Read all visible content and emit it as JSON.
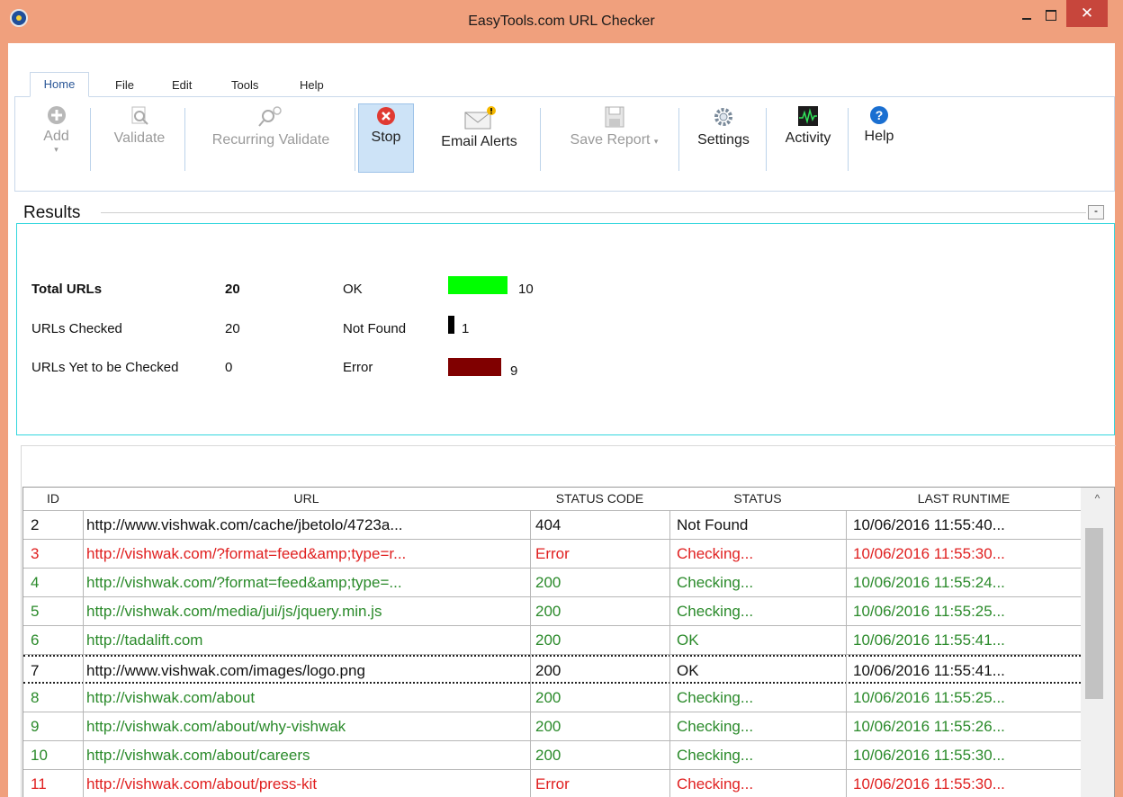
{
  "window": {
    "title": "EasyTools.com URL Checker",
    "close_glyph": "✕"
  },
  "menu": {
    "tabs": [
      "Home",
      "File",
      "Edit",
      "Tools",
      "Help"
    ]
  },
  "toolbar": {
    "add": "Add",
    "validate": "Validate",
    "recurring_validate": "Recurring Validate",
    "stop": "Stop",
    "email_alerts": "Email Alerts",
    "save_report": "Save Report",
    "settings": "Settings",
    "activity": "Activity",
    "help": "Help"
  },
  "results": {
    "title": "Results",
    "collapse": "-",
    "total_label": "Total URLs",
    "total_value": "20",
    "checked_label": "URLs Checked",
    "checked_value": "20",
    "pending_label": "URLs Yet to be Checked",
    "pending_value": "0",
    "ok_label": "OK",
    "ok_value": "10",
    "notfound_label": "Not Found",
    "notfound_value": "1",
    "error_label": "Error",
    "error_value": "9",
    "colors": {
      "ok": "#00ff00",
      "notfound": "#000000",
      "error": "#800000"
    }
  },
  "table": {
    "columns": [
      "ID",
      "URL",
      "STATUS CODE",
      "STATUS",
      "LAST RUNTIME"
    ],
    "rows": [
      {
        "id": "2",
        "url": "http://www.vishwak.com/cache/jbetolo/4723a...",
        "code": "404",
        "status": "Not Found",
        "runtime": "10/06/2016  11:55:40...",
        "color": "black"
      },
      {
        "id": "3",
        "url": "http://vishwak.com/?format=feed&amp;type=r...",
        "code": "Error",
        "status": "Checking...",
        "runtime": "10/06/2016  11:55:30...",
        "color": "red"
      },
      {
        "id": "4",
        "url": "http://vishwak.com/?format=feed&amp;type=...",
        "code": "200",
        "status": "Checking...",
        "runtime": "10/06/2016  11:55:24...",
        "color": "green"
      },
      {
        "id": "5",
        "url": "http://vishwak.com/media/jui/js/jquery.min.js",
        "code": "200",
        "status": "Checking...",
        "runtime": "10/06/2016  11:55:25...",
        "color": "green"
      },
      {
        "id": "6",
        "url": "http://tadalift.com",
        "code": "200",
        "status": "OK",
        "runtime": "10/06/2016  11:55:41...",
        "color": "green"
      },
      {
        "id": "7",
        "url": "http://www.vishwak.com/images/logo.png",
        "code": "200",
        "status": "OK",
        "runtime": "10/06/2016  11:55:41...",
        "color": "black"
      },
      {
        "id": "8",
        "url": "http://vishwak.com/about",
        "code": "200",
        "status": "Checking...",
        "runtime": "10/06/2016  11:55:25...",
        "color": "green"
      },
      {
        "id": "9",
        "url": "http://vishwak.com/about/why-vishwak",
        "code": "200",
        "status": "Checking...",
        "runtime": "10/06/2016  11:55:26...",
        "color": "green"
      },
      {
        "id": "10",
        "url": "http://vishwak.com/about/careers",
        "code": "200",
        "status": "Checking...",
        "runtime": "10/06/2016  11:55:30...",
        "color": "green"
      },
      {
        "id": "11",
        "url": "http://vishwak.com/about/press-kit",
        "code": "Error",
        "status": "Checking...",
        "runtime": "10/06/2016  11:55:30...",
        "color": "red"
      }
    ]
  }
}
